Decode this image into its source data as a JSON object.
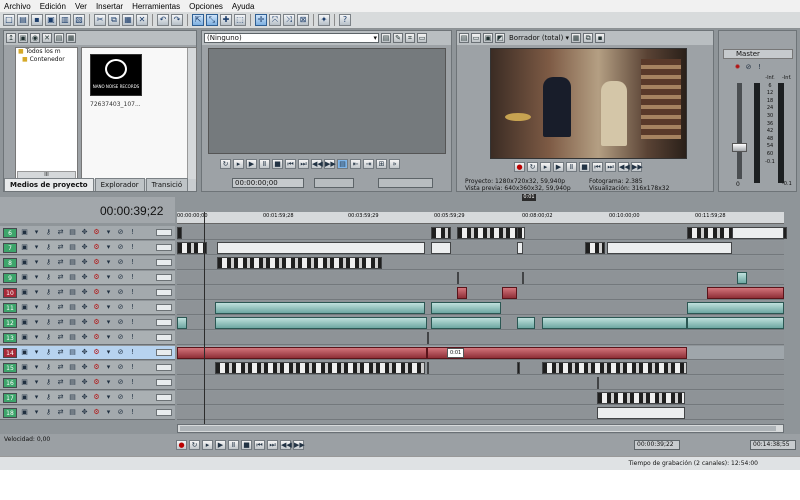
{
  "menu": [
    "Archivo",
    "Edición",
    "Ver",
    "Insertar",
    "Herramientas",
    "Opciones",
    "Ayuda"
  ],
  "explorer": {
    "tree": [
      "Todos los m",
      "Contenedor"
    ],
    "media_name": "72637403_107...",
    "logo_text": "NANO NOISE RECORDS",
    "scroll_label": "III",
    "tabs": [
      "Medios de proyecto",
      "Explorador",
      "Transició"
    ]
  },
  "trimmer": {
    "source": "(Ninguno)",
    "timecode": "00:00:00;00"
  },
  "preview": {
    "mode": "Borrador (total)",
    "proyecto_label": "Proyecto:",
    "proyecto_value": "1280x720x32, 59,940p",
    "vista_label": "Vista previa:",
    "vista_value": "640x360x32, 59,940p",
    "fotograma_label": "Fotograma:",
    "fotograma_value": "2.385",
    "visual_label": "Visualización:",
    "visual_value": "316x178x32"
  },
  "master": {
    "title": "Master",
    "scale": [
      "-Inf.",
      "-Inf.",
      "6",
      "12",
      "18",
      "24",
      "30",
      "36",
      "42",
      "48",
      "54",
      "60",
      "-0.1",
      "-0.1"
    ],
    "level": "0"
  },
  "timeline": {
    "position": "00:00:39;22",
    "marker": "0:01",
    "ruler": [
      "00:00:00;00",
      "00:01:59;28",
      "00:03:59;29",
      "00:05:59;29",
      "00:08:00;02",
      "00:10:00;00",
      "00:11:59;28"
    ],
    "clip_label": "0:01",
    "end_time": "00:00:39;22",
    "total_time": "00:14:38;55"
  },
  "tracks": [
    "6",
    "7",
    "8",
    "9",
    "10",
    "11",
    "12",
    "13",
    "14",
    "15",
    "16",
    "17",
    "18"
  ],
  "status": {
    "velocidad": "Velocidad: 0,00",
    "recording": "Tiempo de grabación (2 canales): 12:54:00"
  },
  "colors": {
    "track_video": "#3da56b",
    "track_audio": "#a72a38",
    "panel": "#9da2a6",
    "timeline": "#8e9397"
  }
}
